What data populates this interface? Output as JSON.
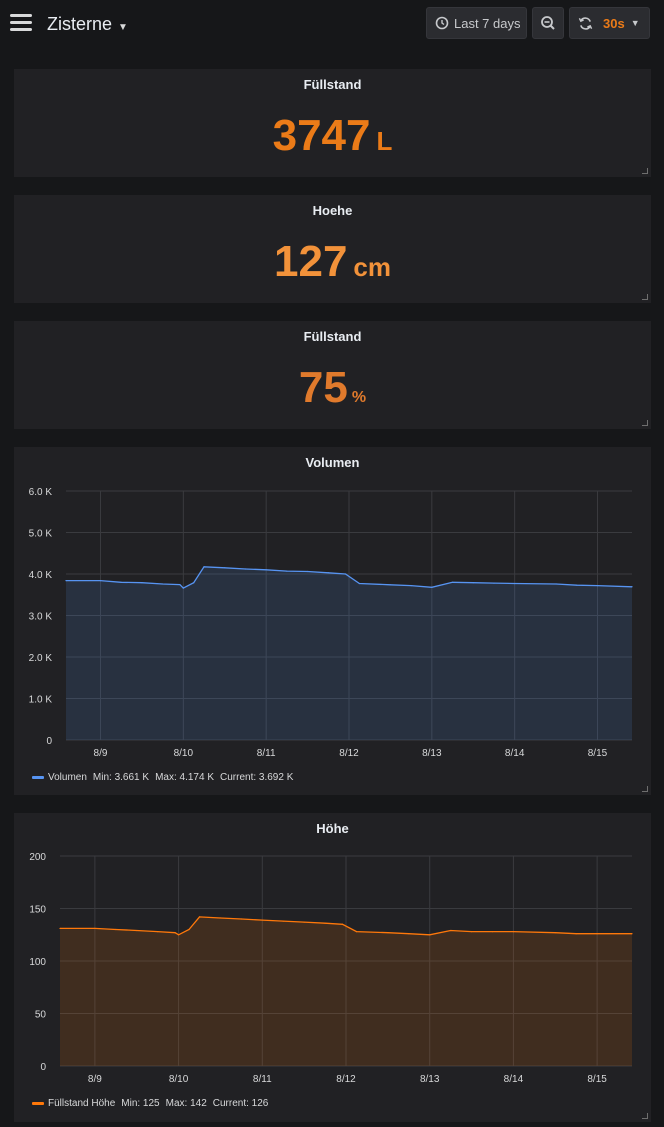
{
  "header": {
    "title": "Zisterne",
    "time_range": "Last 7 days",
    "refresh_interval": "30s"
  },
  "stats": [
    {
      "title": "Füllstand",
      "value": "3747",
      "unit": "L",
      "color": "#eb7b18"
    },
    {
      "title": "Hoehe",
      "value": "127",
      "unit": "cm",
      "color": "#f2923a"
    },
    {
      "title": "Füllstand",
      "value": "75",
      "unit": "%",
      "color": "#e07a2c"
    }
  ],
  "volumen": {
    "title": "Volumen",
    "legend": {
      "name": "Volumen",
      "min": "Min: 3.661 K",
      "max": "Max: 4.174 K",
      "current": "Current: 3.692 K"
    }
  },
  "hoehe_chart": {
    "title": "Höhe",
    "legend": {
      "name": "Füllstand Höhe",
      "min": "Min: 125",
      "max": "Max: 142",
      "current": "Current: 126"
    }
  },
  "chart_data": [
    {
      "type": "area",
      "title": "Volumen",
      "color": "#5794f2",
      "x_ticks": [
        "8/9",
        "8/10",
        "8/11",
        "8/12",
        "8/13",
        "8/14",
        "8/15"
      ],
      "y_ticks": [
        "0",
        "1.0 K",
        "2.0 K",
        "3.0 K",
        "4.0 K",
        "5.0 K",
        "6.0 K"
      ],
      "ylim": [
        0,
        6000
      ],
      "xlim": [
        "8/8 14:00",
        "8/15 10:00"
      ],
      "series": [
        {
          "name": "Volumen",
          "points": [
            [
              "8/8 14:00",
              3840
            ],
            [
              "8/9 00:00",
              3840
            ],
            [
              "8/9 06:00",
              3800
            ],
            [
              "8/9 12:00",
              3790
            ],
            [
              "8/9 18:00",
              3760
            ],
            [
              "8/9 23:00",
              3745
            ],
            [
              "8/10 00:00",
              3661
            ],
            [
              "8/10 03:00",
              3790
            ],
            [
              "8/10 06:00",
              4174
            ],
            [
              "8/10 12:00",
              4150
            ],
            [
              "8/10 18:00",
              4120
            ],
            [
              "8/11 00:00",
              4100
            ],
            [
              "8/11 06:00",
              4070
            ],
            [
              "8/11 12:00",
              4060
            ],
            [
              "8/11 18:00",
              4030
            ],
            [
              "8/11 23:00",
              4000
            ],
            [
              "8/12 03:00",
              3770
            ],
            [
              "8/12 12:00",
              3740
            ],
            [
              "8/12 18:00",
              3720
            ],
            [
              "8/13 00:00",
              3680
            ],
            [
              "8/13 06:00",
              3800
            ],
            [
              "8/13 12:00",
              3790
            ],
            [
              "8/13 18:00",
              3780
            ],
            [
              "8/14 00:00",
              3770
            ],
            [
              "8/14 12:00",
              3760
            ],
            [
              "8/14 18:00",
              3730
            ],
            [
              "8/15 00:00",
              3720
            ],
            [
              "8/15 10:00",
              3692
            ]
          ]
        }
      ]
    },
    {
      "type": "area",
      "title": "Höhe",
      "color": "#ff780a",
      "x_ticks": [
        "8/9",
        "8/10",
        "8/11",
        "8/12",
        "8/13",
        "8/14",
        "8/15"
      ],
      "y_ticks": [
        "0",
        "50",
        "100",
        "150",
        "200"
      ],
      "ylim": [
        0,
        200
      ],
      "xlim": [
        "8/8 14:00",
        "8/15 10:00"
      ],
      "series": [
        {
          "name": "Füllstand Höhe",
          "points": [
            [
              "8/8 14:00",
              131
            ],
            [
              "8/9 00:00",
              131
            ],
            [
              "8/9 06:00",
              130
            ],
            [
              "8/9 12:00",
              129
            ],
            [
              "8/9 18:00",
              128
            ],
            [
              "8/9 23:00",
              127
            ],
            [
              "8/10 00:00",
              125
            ],
            [
              "8/10 03:00",
              130
            ],
            [
              "8/10 06:00",
              142
            ],
            [
              "8/10 12:00",
              141
            ],
            [
              "8/10 18:00",
              140
            ],
            [
              "8/11 00:00",
              139
            ],
            [
              "8/11 06:00",
              138
            ],
            [
              "8/11 12:00",
              137
            ],
            [
              "8/11 18:00",
              136
            ],
            [
              "8/11 23:00",
              135
            ],
            [
              "8/12 03:00",
              128
            ],
            [
              "8/12 12:00",
              127
            ],
            [
              "8/12 18:00",
              126
            ],
            [
              "8/13 00:00",
              125
            ],
            [
              "8/13 06:00",
              129
            ],
            [
              "8/13 12:00",
              128
            ],
            [
              "8/13 18:00",
              128
            ],
            [
              "8/14 00:00",
              128
            ],
            [
              "8/14 12:00",
              127
            ],
            [
              "8/14 18:00",
              126
            ],
            [
              "8/15 00:00",
              126
            ],
            [
              "8/15 10:00",
              126
            ]
          ]
        }
      ]
    }
  ]
}
